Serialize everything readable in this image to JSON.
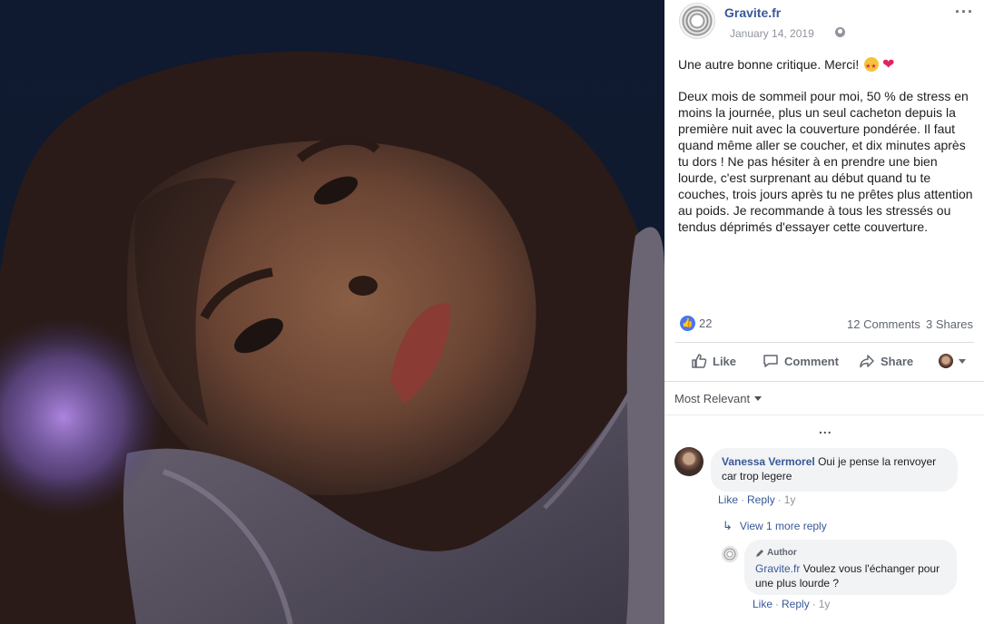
{
  "post": {
    "page_name": "Gravite.fr",
    "date": "January 14, 2019",
    "date_sep": "·",
    "text_intro": "Une autre bonne critique. Merci!",
    "text_body": "Deux mois de sommeil pour moi, 50 % de stress en moins la journée, plus un seul cacheton depuis la première nuit avec la couverture pondérée. Il faut quand même aller se coucher, et dix minutes après tu dors ! Ne pas hésiter à en prendre une bien lourde, c'est surprenant au début quand tu te couches, trois jours après tu ne prêtes plus attention au poids. Je recommande à tous les stressés ou tendus déprimés d'essayer cette couverture.",
    "emojis": [
      "star-struck-emoji",
      "heart-emoji"
    ]
  },
  "stats": {
    "likes": "22",
    "comments": "12 Comments",
    "shares": "3 Shares"
  },
  "actions": {
    "like": "Like",
    "comment": "Comment",
    "share": "Share"
  },
  "comments_section": {
    "sort_label": "Most Relevant",
    "more_indicator": "...",
    "comments": [
      {
        "author": "Vanessa Vermorel",
        "text": "Oui je pense la renvoyer car trop legere",
        "like": "Like",
        "reply": "Reply",
        "age": "1y"
      }
    ],
    "view_more_replies": "View 1 more reply",
    "reply": {
      "badge": "Author",
      "author": "Gravite.fr",
      "text": "Voulez vous l'échanger pour une plus lourde ?",
      "like": "Like",
      "reply": "Reply",
      "age": "1y"
    }
  },
  "colors": {
    "link_blue": "#385898",
    "like_blue": "#4a76e8",
    "secondary_text": "#606770"
  }
}
